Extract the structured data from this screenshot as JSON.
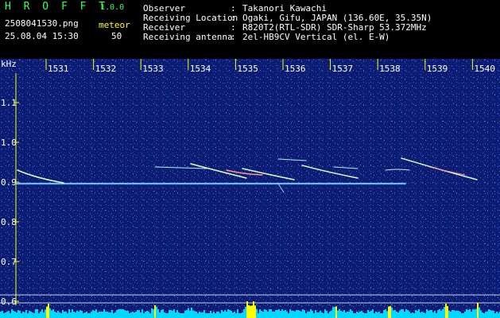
{
  "app": {
    "title": "H R O F F T",
    "version": "1.0.0"
  },
  "file": {
    "name": "2508041530.png",
    "timestamp": "25.08.04 15:30"
  },
  "meteor": {
    "label": "meteor",
    "count": "50"
  },
  "info": [
    {
      "label": "Observer",
      "sep": ":",
      "value": "Takanori Kawachi"
    },
    {
      "label": "Receiving Location",
      "sep": ":",
      "value": "Ogaki, Gifu, JAPAN (136.60E, 35.35N)"
    },
    {
      "label": "Receiver",
      "sep": ":",
      "value": "R820T2(RTL-SDR) SDR-Sharp 53.372MHz"
    },
    {
      "label": "Receiving antenna",
      "sep": ":",
      "value": "2el-HB9CV Vertical (el. E-W)"
    }
  ],
  "spectrogram": {
    "y_unit": "kHz",
    "x_ticks": [
      "1531",
      "1532",
      "1533",
      "1534",
      "1535",
      "1536",
      "1537",
      "1538",
      "1539",
      "1540"
    ],
    "y_ticks": [
      "1.1",
      "1.0",
      "0.9",
      "0.8",
      "0.7",
      "0.6"
    ],
    "colors": {
      "background": "#0a1a6e",
      "text": "#ffffff",
      "axis": "#ffff00",
      "echo": "#d8ffd0",
      "level": "#00d8ff"
    }
  }
}
